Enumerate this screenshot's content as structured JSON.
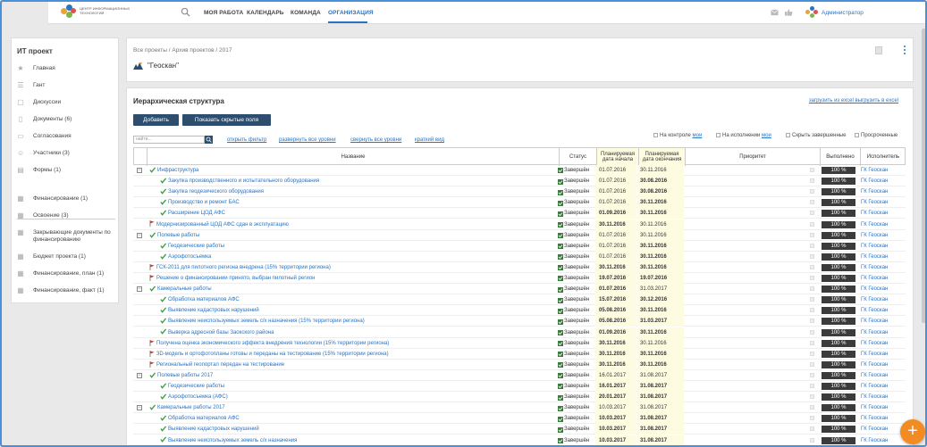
{
  "topnav": {
    "logo_text": "ЦЕНТР ИНФОРМАЦИОННЫХ ТЕХНОЛОГИЙ",
    "items": [
      "МОЯ РАБОТА",
      "КАЛЕНДАРЬ",
      "КОМАНДА",
      "ОРГАНИЗАЦИЯ"
    ],
    "active": "ОРГАНИЗАЦИЯ",
    "user": "Администратор"
  },
  "sidebar": {
    "title": "ИТ проект",
    "items": [
      {
        "label": "Главная",
        "icon": "star-icon"
      },
      {
        "label": "Гант",
        "icon": "gantt-icon"
      },
      {
        "label": "Дискуссии",
        "icon": "chat-icon"
      },
      {
        "label": "Документы (6)",
        "icon": "document-icon"
      },
      {
        "label": "Согласования",
        "icon": "approval-icon"
      },
      {
        "label": "Участники (3)",
        "icon": "people-icon"
      },
      {
        "label": "Формы (1)",
        "icon": "form-icon"
      },
      {
        "label": "Финансирование (1)",
        "icon": "table-icon"
      },
      {
        "label": "Освоение (3)",
        "icon": "table-icon"
      },
      {
        "label": "Закрывающие документы по финансированию",
        "icon": "table-icon"
      },
      {
        "label": "Бюджет проекта (1)",
        "icon": "table-icon"
      },
      {
        "label": "Финансирование, план (1)",
        "icon": "table-icon"
      },
      {
        "label": "Финансирование, факт (1)",
        "icon": "table-icon"
      }
    ]
  },
  "project": {
    "breadcrumb": "Все проекты / Архив проектов / 2017",
    "name": "\"Геоскан\""
  },
  "main": {
    "title": "Иерархическая структура",
    "excel_links": "загрузить из excel выгрузить в excel",
    "add_button": "Добавить",
    "show_hidden_button": "Показать скрытые поля",
    "filter_placeholder": "найти...",
    "links": [
      "открыть фильтр",
      "развернуть все уровни",
      "свернуть все уровни",
      "краткий вид"
    ],
    "checks": {
      "on_control": "На контроле",
      "on_control_link": "мои",
      "on_exec": "На исполнении",
      "on_exec_link": "мои",
      "hide_done": "Скрыть завершенные",
      "overdue": "Просроченные"
    },
    "columns": {
      "name": "Название",
      "status": "Статус",
      "plan_start": "Планируемая дата начала",
      "plan_end": "Планируемая дата окончания",
      "priority": "Приоритет",
      "done": "Выполнено",
      "executor": "Исполнитель"
    }
  },
  "rows": [
    {
      "level": 0,
      "exp": true,
      "mark": "check",
      "name": "Инфраструктура",
      "status": "Завершён",
      "start": "01.07.2016",
      "end": "30.11.2016",
      "sb": false,
      "eb": false,
      "done": "100 %",
      "exec": "ГК Геоскан"
    },
    {
      "level": 1,
      "exp": false,
      "mark": "check",
      "name": "Закупка производственного и испытательного оборудования",
      "status": "Завершён",
      "start": "01.07.2016",
      "end": "30.08.2016",
      "sb": false,
      "eb": true,
      "done": "100 %",
      "exec": "ГК Геоскан"
    },
    {
      "level": 1,
      "exp": false,
      "mark": "check",
      "name": "Закупка геодезического оборудования",
      "status": "Завершён",
      "start": "01.07.2016",
      "end": "30.08.2016",
      "sb": false,
      "eb": true,
      "done": "100 %",
      "exec": "ГК Геоскан"
    },
    {
      "level": 1,
      "exp": false,
      "mark": "check",
      "name": "Производство и ремонт БАС",
      "status": "Завершён",
      "start": "01.07.2016",
      "end": "30.11.2016",
      "sb": false,
      "eb": true,
      "done": "100 %",
      "exec": "ГК Геоскан"
    },
    {
      "level": 1,
      "exp": false,
      "mark": "check",
      "name": "Расширение ЦОД АФС",
      "status": "Завершён",
      "start": "01.09.2016",
      "end": "30.11.2016",
      "sb": true,
      "eb": true,
      "done": "100 %",
      "exec": "ГК Геоскан"
    },
    {
      "level": 0,
      "exp": false,
      "mark": "flag",
      "name": "Модернизированный ЦОД АФС сдан в эксплуатацию",
      "status": "Завершён",
      "start": "30.11.2016",
      "end": "30.11.2016",
      "sb": true,
      "eb": false,
      "done": "100 %",
      "exec": "ГК Геоскан"
    },
    {
      "level": 0,
      "exp": true,
      "mark": "check",
      "name": "Полевые работы",
      "status": "Завершён",
      "start": "01.07.2016",
      "end": "30.11.2016",
      "sb": false,
      "eb": false,
      "done": "100 %",
      "exec": "ГК Геоскан"
    },
    {
      "level": 1,
      "exp": false,
      "mark": "check",
      "name": "Геодезические работы",
      "status": "Завершён",
      "start": "01.07.2016",
      "end": "30.11.2016",
      "sb": false,
      "eb": true,
      "done": "100 %",
      "exec": "ГК Геоскан"
    },
    {
      "level": 1,
      "exp": false,
      "mark": "check",
      "name": "Аэрофотосъемка",
      "status": "Завершён",
      "start": "01.07.2016",
      "end": "30.11.2016",
      "sb": false,
      "eb": true,
      "done": "100 %",
      "exec": "ГК Геоскан"
    },
    {
      "level": 0,
      "exp": false,
      "mark": "flag",
      "name": "ГСК-2011 для пилотного региона внедрена (15% территории региона)",
      "status": "Завершён",
      "start": "30.11.2016",
      "end": "30.11.2016",
      "sb": true,
      "eb": true,
      "done": "100 %",
      "exec": "ГК Геоскан"
    },
    {
      "level": 0,
      "exp": false,
      "mark": "flag",
      "name": "Решение о финансировании принято, выбран пилотный регион",
      "status": "Завершён",
      "start": "19.07.2016",
      "end": "19.07.2016",
      "sb": true,
      "eb": true,
      "done": "100 %",
      "exec": "ГК Геоскан"
    },
    {
      "level": 0,
      "exp": true,
      "mark": "check",
      "name": "Камеральные работы",
      "status": "Завершён",
      "start": "01.07.2016",
      "end": "31.03.2017",
      "sb": true,
      "eb": false,
      "done": "100 %",
      "exec": "ГК Геоскан"
    },
    {
      "level": 1,
      "exp": false,
      "mark": "check",
      "name": "Обработка материалов АФС",
      "status": "Завершён",
      "start": "15.07.2016",
      "end": "30.12.2016",
      "sb": true,
      "eb": true,
      "done": "100 %",
      "exec": "ГК Геоскан"
    },
    {
      "level": 1,
      "exp": false,
      "mark": "check",
      "name": "Выявление кадастровых нарушений",
      "status": "Завершён",
      "start": "05.08.2016",
      "end": "30.11.2016",
      "sb": true,
      "eb": true,
      "done": "100 %",
      "exec": "ГК Геоскан"
    },
    {
      "level": 1,
      "exp": false,
      "mark": "check",
      "name": "Выявление неиспользуемых земель с/х назначения (15% территории региона)",
      "status": "Завершён",
      "start": "05.08.2016",
      "end": "31.03.2017",
      "sb": true,
      "eb": true,
      "done": "100 %",
      "exec": "ГК Геоскан"
    },
    {
      "level": 1,
      "exp": false,
      "mark": "check",
      "name": "Выверка адресной базы Заокского района",
      "status": "Завершён",
      "start": "01.09.2016",
      "end": "30.11.2016",
      "sb": true,
      "eb": true,
      "done": "100 %",
      "exec": "ГК Геоскан"
    },
    {
      "level": 0,
      "exp": false,
      "mark": "flag",
      "name": "Получена оценка экономического эффекта внедрения технологии (15% территории региона)",
      "status": "Завершён",
      "start": "30.11.2016",
      "end": "30.11.2016",
      "sb": true,
      "eb": false,
      "done": "100 %",
      "exec": "ГК Геоскан"
    },
    {
      "level": 0,
      "exp": false,
      "mark": "flag",
      "name": "3D-модель и ортофотопланы готовы и переданы на тестирование (15% территории региона)",
      "status": "Завершён",
      "start": "30.11.2016",
      "end": "30.11.2016",
      "sb": true,
      "eb": true,
      "done": "100 %",
      "exec": "ГК Геоскан"
    },
    {
      "level": 0,
      "exp": false,
      "mark": "flag",
      "name": "Региональный геопортал передан на тестирование",
      "status": "Завершён",
      "start": "30.11.2016",
      "end": "30.11.2016",
      "sb": true,
      "eb": true,
      "done": "100 %",
      "exec": "ГК Геоскан"
    },
    {
      "level": 0,
      "exp": true,
      "mark": "check",
      "name": "Полевые работы 2017",
      "status": "Завершён",
      "start": "16.01.2017",
      "end": "31.08.2017",
      "sb": false,
      "eb": false,
      "done": "100 %",
      "exec": "ГК Геоскан"
    },
    {
      "level": 1,
      "exp": false,
      "mark": "check",
      "name": "Геодезические работы",
      "status": "Завершён",
      "start": "16.01.2017",
      "end": "31.08.2017",
      "sb": true,
      "eb": true,
      "done": "100 %",
      "exec": "ГК Геоскан"
    },
    {
      "level": 1,
      "exp": false,
      "mark": "check",
      "name": "Аэрофотосъемка (АФС)",
      "status": "Завершён",
      "start": "20.01.2017",
      "end": "31.08.2017",
      "sb": true,
      "eb": true,
      "done": "100 %",
      "exec": "ГК Геоскан"
    },
    {
      "level": 0,
      "exp": true,
      "mark": "check",
      "name": "Камеральные работы 2017",
      "status": "Завершён",
      "start": "10.03.2017",
      "end": "31.08.2017",
      "sb": false,
      "eb": false,
      "done": "100 %",
      "exec": "ГК Геоскан"
    },
    {
      "level": 1,
      "exp": false,
      "mark": "check",
      "name": "Обработка материалов АФС",
      "status": "Завершён",
      "start": "10.03.2017",
      "end": "31.08.2017",
      "sb": true,
      "eb": true,
      "done": "100 %",
      "exec": "ГК Геоскан"
    },
    {
      "level": 1,
      "exp": false,
      "mark": "check",
      "name": "Выявление кадастровых нарушений",
      "status": "Завершён",
      "start": "10.03.2017",
      "end": "31.08.2017",
      "sb": true,
      "eb": true,
      "done": "100 %",
      "exec": "ГК Геоскан"
    },
    {
      "level": 1,
      "exp": false,
      "mark": "check",
      "name": "Выявление неиспользуемых земель с/х назначения",
      "status": "Завершён",
      "start": "10.03.2017",
      "end": "31.08.2017",
      "sb": true,
      "eb": true,
      "done": "100 %",
      "exec": "ГК Геоскан"
    }
  ],
  "colors": {
    "accent": "#2874c5",
    "button": "#2d4e6e",
    "fab": "#f28b21",
    "date_bg": "#fdfbe0"
  }
}
